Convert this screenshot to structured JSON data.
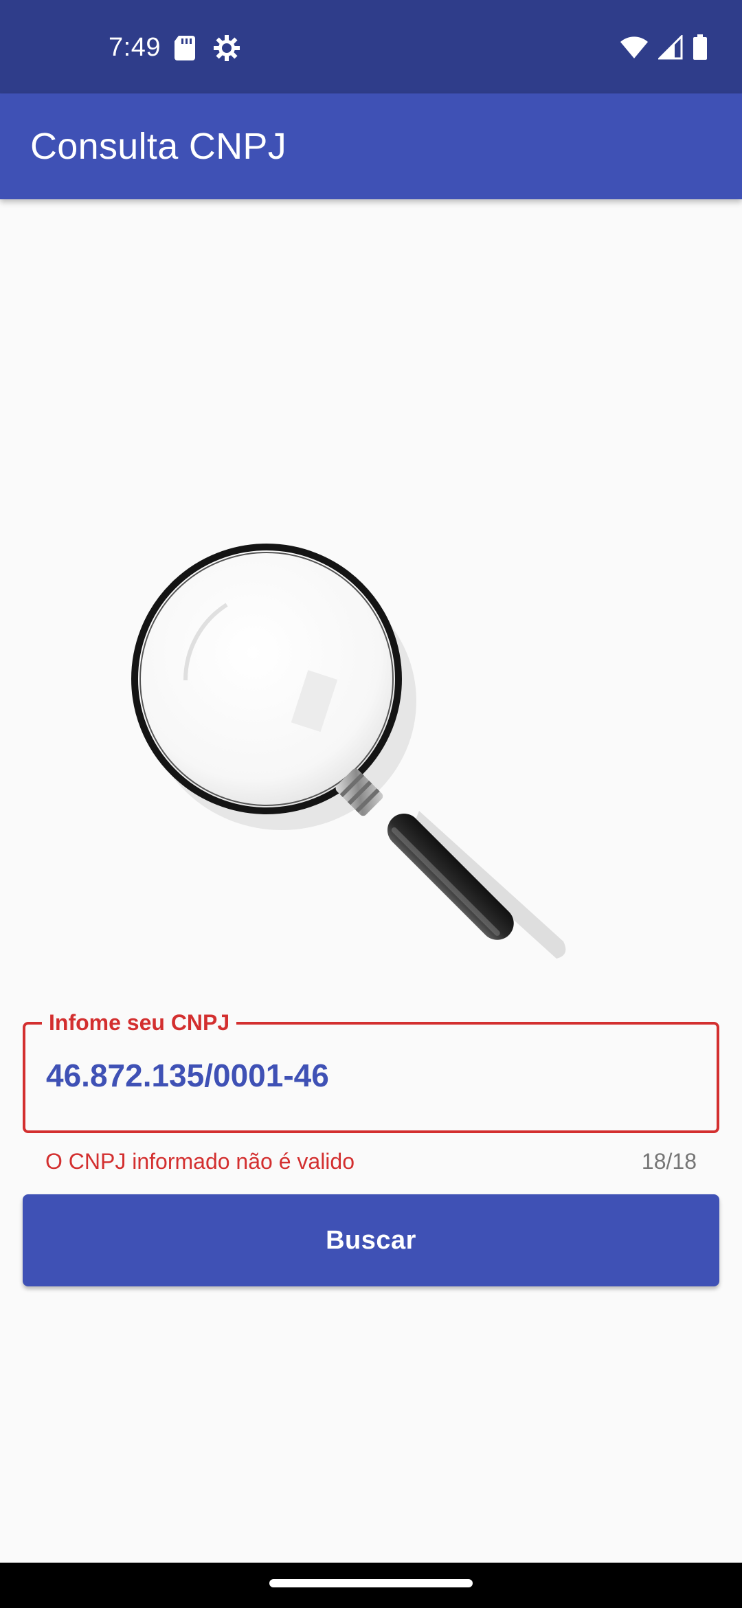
{
  "status_bar": {
    "time": "7:49",
    "icons": [
      "sd-card-icon",
      "settings-gear-icon",
      "wifi-icon",
      "signal-icon",
      "battery-icon"
    ]
  },
  "app_bar": {
    "title": "Consulta CNPJ"
  },
  "hero_image": {
    "icon": "magnifying-glass-icon"
  },
  "form": {
    "field_label": "Infome seu CNPJ",
    "field_value": "46.872.135/0001-46",
    "error_message": "O CNPJ informado não é valido",
    "counter": "18/18",
    "button_label": "Buscar"
  },
  "colors": {
    "primary": "#3f51b5",
    "primary_dark": "#2f3d8a",
    "error": "#d32f2f",
    "background": "#fafafa"
  }
}
